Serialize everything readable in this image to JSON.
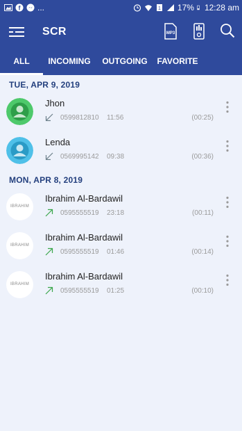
{
  "status_bar": {
    "battery": "17%",
    "time": "12:28 am",
    "notif": "..."
  },
  "app": {
    "title": "SCR"
  },
  "tabs": [
    {
      "label": "ALL",
      "active": true
    },
    {
      "label": "INCOMING",
      "active": false
    },
    {
      "label": "OUTGOING",
      "active": false
    },
    {
      "label": "FAVORITE",
      "active": false
    }
  ],
  "sections": [
    {
      "date": "TUE, APR 9, 2019",
      "calls": [
        {
          "name": "Jhon",
          "number": "0599812810",
          "time": "11:56",
          "duration": "(00:25)",
          "direction": "incoming",
          "avatar": "green-person"
        },
        {
          "name": "Lenda",
          "number": "0569995142",
          "time": "09:38",
          "duration": "(00:36)",
          "direction": "incoming",
          "avatar": "blue-person"
        }
      ]
    },
    {
      "date": "MON, APR 8, 2019",
      "calls": [
        {
          "name": "Ibrahim Al-Bardawil",
          "number": "0595555519",
          "time": "23:18",
          "duration": "(00:11)",
          "direction": "outgoing",
          "avatar_text": "IBRAHIM"
        },
        {
          "name": "Ibrahim Al-Bardawil",
          "number": "0595555519",
          "time": "01:46",
          "duration": "(00:14)",
          "direction": "outgoing",
          "avatar_text": "IBRAHIM"
        },
        {
          "name": "Ibrahim Al-Bardawil",
          "number": "0595555519",
          "time": "01:25",
          "duration": "(00:10)",
          "direction": "outgoing",
          "avatar_text": "IBRAHIM"
        }
      ]
    }
  ],
  "colors": {
    "primary": "#2f4a9c",
    "background": "#eef2fb",
    "incoming_arrow": "#6b7f8a",
    "outgoing_arrow": "#39a64a",
    "green_avatar": "#4ec96b",
    "blue_avatar": "#4fc0e8"
  }
}
